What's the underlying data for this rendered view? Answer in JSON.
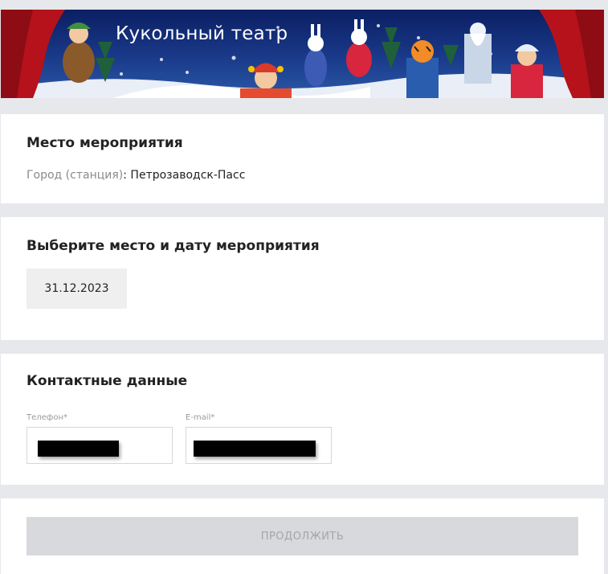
{
  "banner": {
    "title": "Кукольный театр"
  },
  "venue": {
    "heading": "Место мероприятия",
    "city_label": "Город (станция)",
    "separator": ":",
    "city_value": "Петрозаводск-Пасс"
  },
  "date_section": {
    "heading": "Выберите место и дату мероприятия",
    "dates": [
      "31.12.2023"
    ]
  },
  "contacts": {
    "heading": "Контактные данные",
    "phone_label": "Телефон*",
    "email_label": "E-mail*"
  },
  "footer": {
    "continue_label": "ПРОДОЛЖИТЬ"
  },
  "colors": {
    "page_background": "#e6e8ec",
    "card_background": "#ffffff",
    "chip_background": "#efefef",
    "button_disabled_background": "#d8d9dc",
    "button_disabled_text": "#a4a5a9",
    "curtain_red": "#b5121b"
  }
}
